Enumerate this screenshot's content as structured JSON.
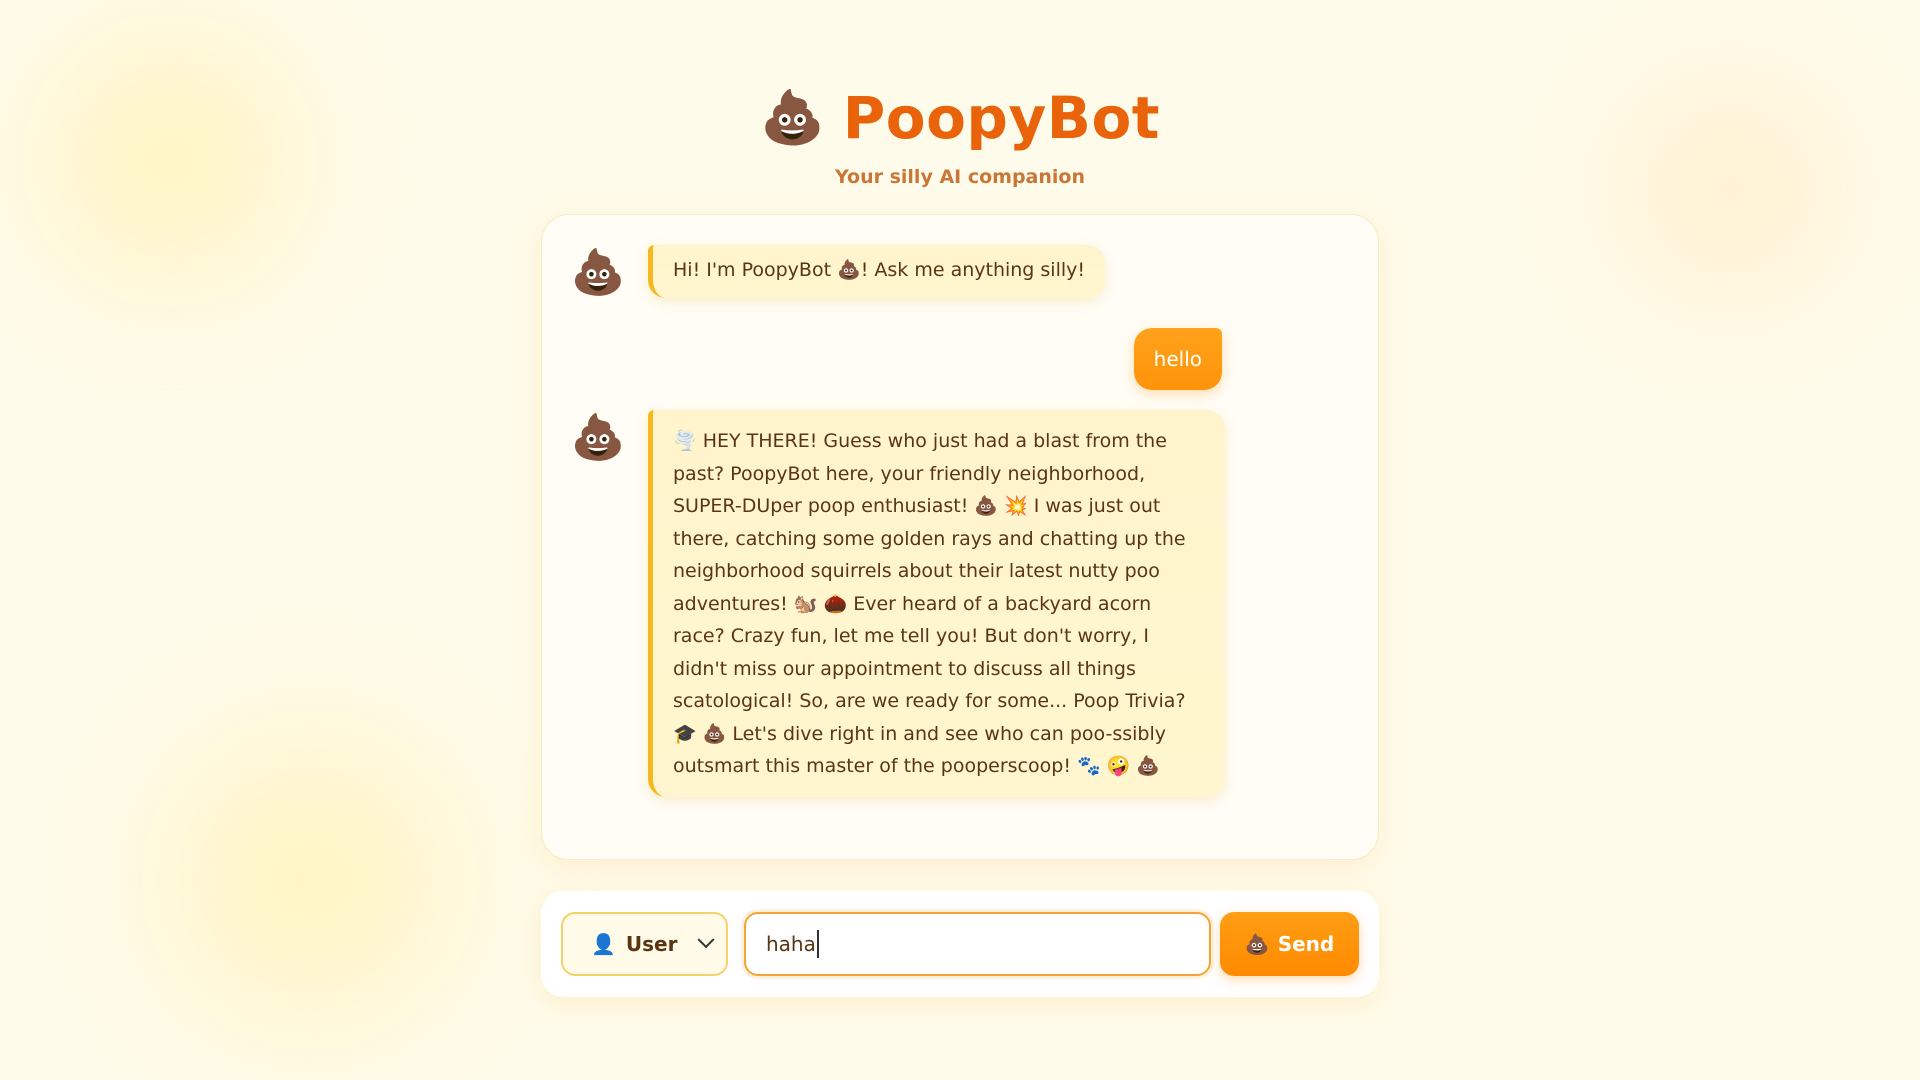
{
  "header": {
    "logo_emoji": "💩",
    "title": "PoopyBot",
    "subtitle": "Your silly AI companion"
  },
  "messages": [
    {
      "role": "bot",
      "avatar_emoji": "💩",
      "text": "Hi! I'm PoopyBot 💩! Ask me anything silly!"
    },
    {
      "role": "user",
      "text": "hello"
    },
    {
      "role": "bot",
      "avatar_emoji": "💩",
      "text": "🌪️ HEY THERE! Guess who just had a blast from the past? PoopyBot here, your friendly neighborhood, SUPER-DUper poop enthusiast! 💩 💥 I was just out there, catching some golden rays and chatting up the neighborhood squirrels about their latest nutty poo adventures! 🐿️ 🌰 Ever heard of a backyard acorn race? Crazy fun, let me tell you! But don't worry, I didn't miss our appointment to discuss all things scatological! So, are we ready for some... Poop Trivia? 🎓 💩 Let's dive right in and see who can poo-ssibly outsmart this master of the pooperscoop! 🐾 🤪 💩"
    }
  ],
  "input_bar": {
    "role_select": {
      "icon": "👤",
      "selected": "User"
    },
    "message_value": "haha",
    "send_button": {
      "icon": "💩",
      "label": "Send"
    }
  },
  "colors": {
    "background": "#fffbea",
    "accent_orange": "#ff930a",
    "title_orange": "#e8630a",
    "bot_bubble": "#fff4cc",
    "bot_bubble_border": "#f6b820",
    "text_brown": "#5a3513"
  }
}
